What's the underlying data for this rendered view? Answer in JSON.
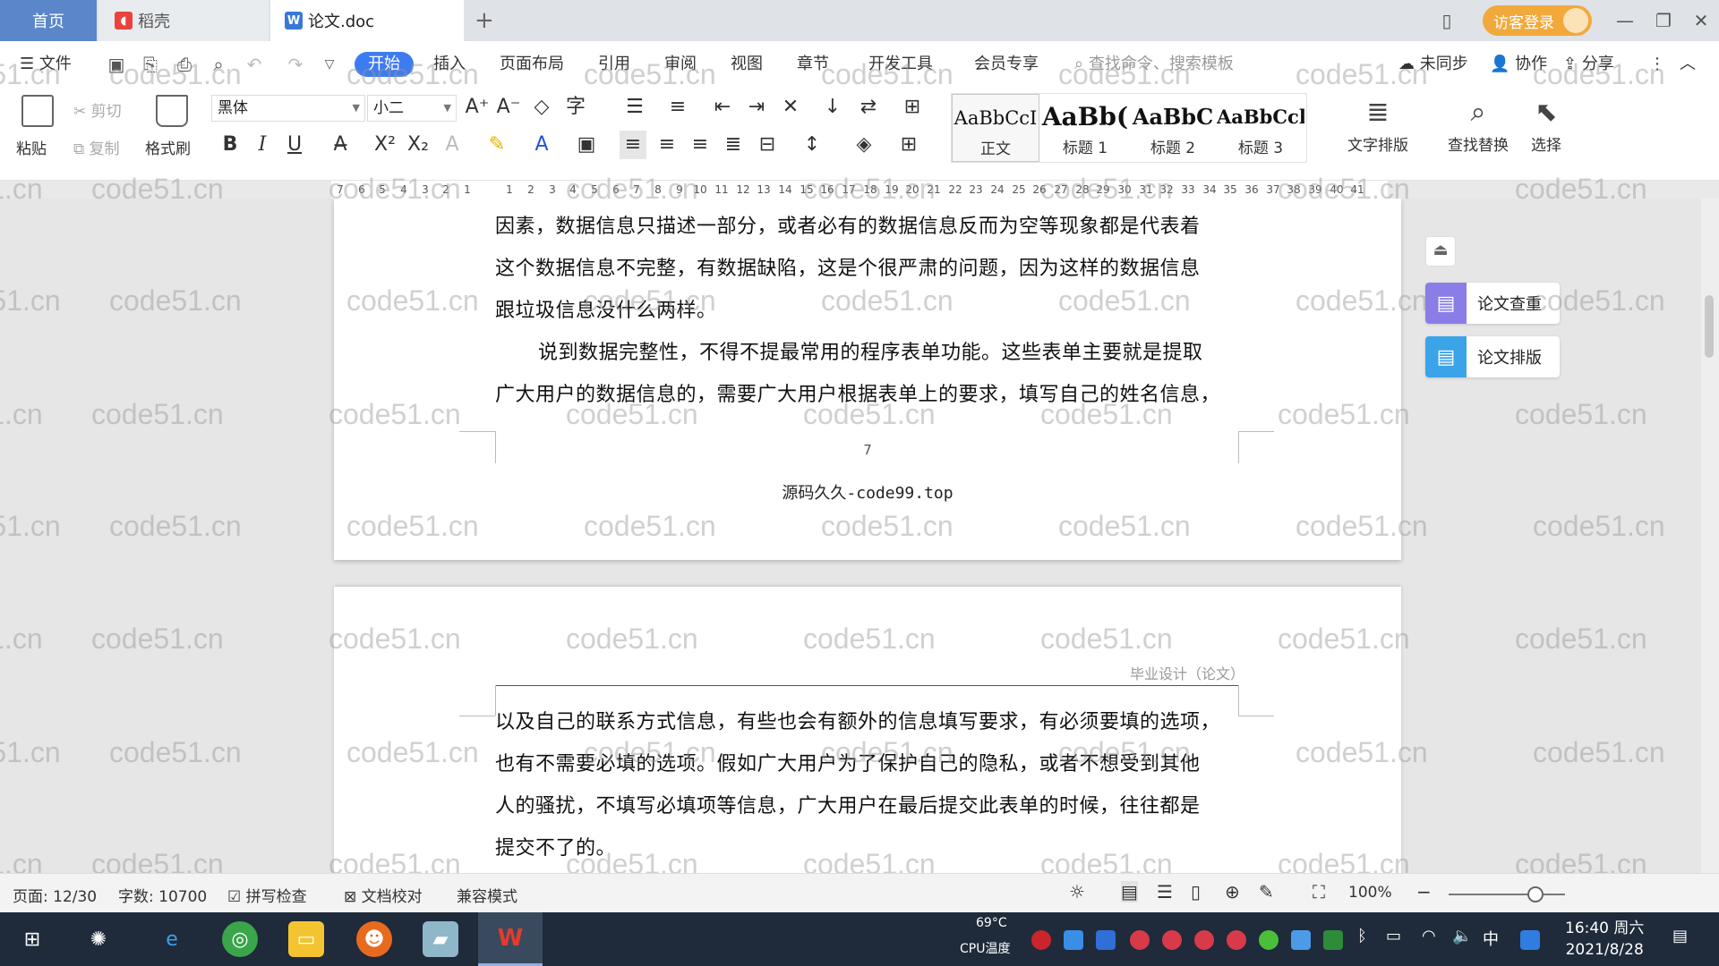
{
  "tabs": {
    "home": "首页",
    "docer": "稻壳",
    "doc": "论文.doc",
    "add": "+"
  },
  "titlebar": {
    "login": "访客登录"
  },
  "menu": {
    "file": "文件",
    "items": [
      "开始",
      "插入",
      "页面布局",
      "引用",
      "审阅",
      "视图",
      "章节",
      "开发工具",
      "会员专享"
    ],
    "search": "查找命令、搜索模板",
    "unsynced": "未同步",
    "collab": "协作",
    "share": "分享"
  },
  "ribbon": {
    "paste": "粘贴",
    "cut": "剪切",
    "copy": "复制",
    "format_painter": "格式刷",
    "font_name": "黑体",
    "font_size": "小二",
    "styles": [
      {
        "sample": "AaBbCcI",
        "label": "正文"
      },
      {
        "sample": "AaBb(",
        "label": "标题 1"
      },
      {
        "sample": "AaBbC",
        "label": "标题 2"
      },
      {
        "sample": "AaBbCcl",
        "label": "标题 3"
      }
    ],
    "text_layout": "文字排版",
    "find_replace": "查找替换",
    "select": "选择"
  },
  "ruler": {
    "ticks": [
      "7",
      "6",
      "5",
      "4",
      "3",
      "2",
      "1",
      "",
      "1",
      "2",
      "3",
      "4",
      "5",
      "6",
      "7",
      "8",
      "9",
      "10",
      "11",
      "12",
      "13",
      "14",
      "15",
      "16",
      "17",
      "18",
      "19",
      "20",
      "21",
      "22",
      "23",
      "24",
      "25",
      "26",
      "27",
      "28",
      "29",
      "30",
      "31",
      "32",
      "33",
      "34",
      "35",
      "36",
      "37",
      "38",
      "39",
      "40",
      "41"
    ]
  },
  "page1": {
    "lines": [
      "因素，数据信息只描述一部分，或者必有的数据信息反而为空等现象都是代表着",
      "这个数据信息不完整，有数据缺陷，这是个很严肃的问题，因为这样的数据信息",
      "跟垃圾信息没什么两样。",
      "说到数据完整性，不得不提最常用的程序表单功能。这些表单主要就是提取",
      "广大用户的数据信息的，需要广大用户根据表单上的要求，填写自己的姓名信息，"
    ],
    "page_number": "7",
    "footer": "源码久久-code99.top"
  },
  "page2": {
    "header": "毕业设计（论文）",
    "lines": [
      "以及自己的联系方式信息，有些也会有额外的信息填写要求，有必须要填的选项，",
      "也有不需要必填的选项。假如广大用户为了保护自己的隐私，或者不想受到其他",
      "人的骚扰，不填写必填项等信息，广大用户在最后提交此表单的时候，往往都是",
      "提交不了的。"
    ]
  },
  "side_panel": {
    "check": "论文查重",
    "layout": "论文排版"
  },
  "watermark": "code51.cn",
  "status": {
    "page": "页面: 12/30",
    "words": "字数: 10700",
    "spell": "拼写检查",
    "proof": "文档校对",
    "compat": "兼容模式",
    "zoom": "100%"
  },
  "taskbar": {
    "cpu_temp": "69°C",
    "cpu_label": "CPU温度",
    "ime": "中",
    "time": "16:40 周六",
    "date": "2021/8/28"
  },
  "colors": {
    "accent": "#3d7bf0",
    "home_tab": "#5b86c9",
    "login": "#f2a93b",
    "taskbar": "#1f2a3a"
  }
}
